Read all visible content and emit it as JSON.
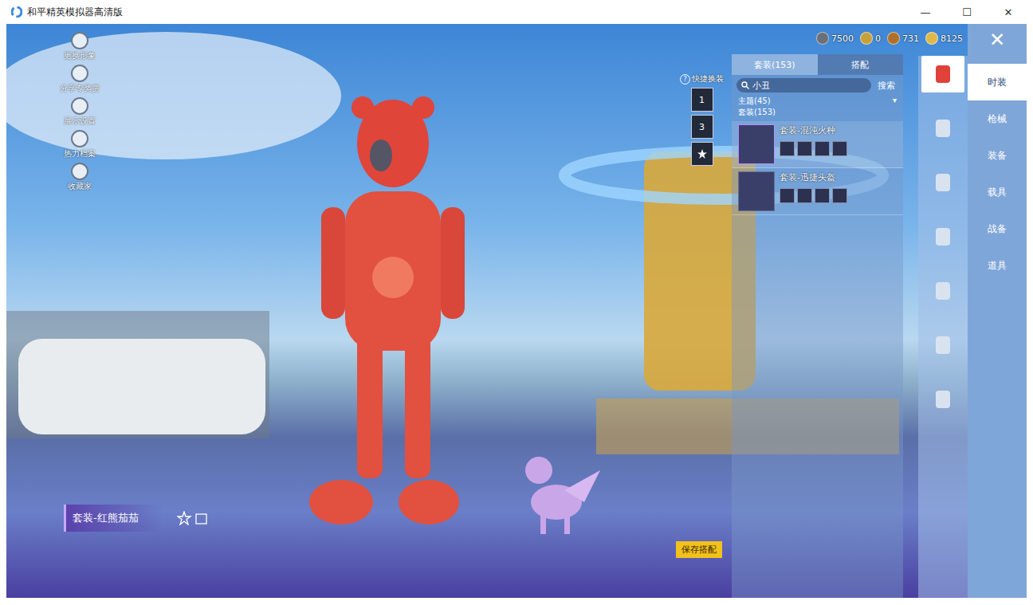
{
  "window": {
    "title": "和平精英模拟器高清版",
    "controls": [
      "—",
      "☐",
      "✕"
    ]
  },
  "left_menu": [
    {
      "label": "更换形象"
    },
    {
      "label": "分享专奖赏"
    },
    {
      "label": "展示设置"
    },
    {
      "label": "热力档案"
    },
    {
      "label": "收藏家"
    }
  ],
  "currencies": [
    {
      "amount": "7500",
      "color": "#6b6f7a"
    },
    {
      "amount": "0",
      "color": "#c9a13a"
    },
    {
      "amount": "731",
      "color": "#b0702a"
    },
    {
      "amount": "8125",
      "color": "#e0b84a"
    }
  ],
  "close": "✕",
  "quick_change": {
    "help": "?",
    "label": "快捷换装",
    "slots": [
      {
        "label": "1",
        "kind": "number"
      },
      {
        "label": "3",
        "kind": "number"
      },
      {
        "kind": "star"
      }
    ]
  },
  "catalog": {
    "tabs": [
      {
        "label": "套装(153)",
        "selected": true
      },
      {
        "label": "搭配",
        "selected": false
      }
    ],
    "search": {
      "value": "小丑",
      "button": "搜索"
    },
    "filter": {
      "label": "主题(45)",
      "arrow": "▾"
    },
    "section": "套装(153)",
    "items": [
      {
        "name": "套装-混沌火种",
        "selected": true
      },
      {
        "name": "套装-迅捷头盔",
        "selected": false
      }
    ]
  },
  "icon_tabs": [
    {
      "selected": true
    },
    {
      "selected": false
    },
    {
      "selected": false
    },
    {
      "selected": false
    },
    {
      "selected": false
    },
    {
      "selected": false
    },
    {
      "selected": false
    }
  ],
  "categories": [
    {
      "label": "时装",
      "selected": true
    },
    {
      "label": "枪械",
      "selected": false
    },
    {
      "label": "装备",
      "selected": false
    },
    {
      "label": "载具",
      "selected": false
    },
    {
      "label": "战备",
      "selected": false
    },
    {
      "label": "道具",
      "selected": false
    }
  ],
  "bottom": {
    "outfit": "套装-红熊茄茄",
    "save": "保存搭配"
  }
}
